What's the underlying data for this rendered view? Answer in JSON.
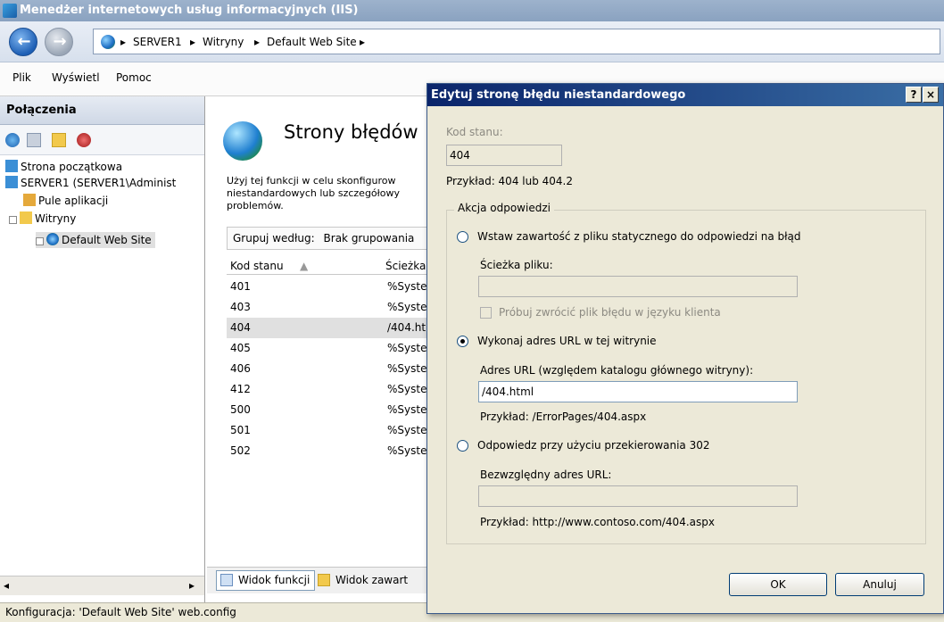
{
  "window": {
    "title": "Menedżer internetowych usług informacyjnych (IIS)"
  },
  "address": {
    "crumbs": [
      "SERVER1",
      "Witryny",
      "Default Web Site"
    ]
  },
  "menu": {
    "items": [
      "Plik",
      "Wyświetl",
      "Pomoc"
    ]
  },
  "connections": {
    "title": "Połączenia",
    "tree": [
      {
        "label": "Strona początkowa"
      },
      {
        "label": "SERVER1 (SERVER1\\Administ"
      },
      {
        "label": "Pule aplikacji"
      },
      {
        "label": "Witryny"
      },
      {
        "label": "Default Web Site"
      }
    ]
  },
  "page": {
    "title": "Strony błędów",
    "desc": "Użyj tej funkcji w celu skonfigurow niestandardowych lub szczegółowy problemów.",
    "group_label": "Grupuj według:",
    "group_value": "Brak grupowania",
    "col_code": "Kod stanu",
    "col_path": "Ścieżka",
    "rows": [
      {
        "code": "401",
        "path": "%Systen"
      },
      {
        "code": "403",
        "path": "%Systen"
      },
      {
        "code": "404",
        "path": "/404.htm"
      },
      {
        "code": "405",
        "path": "%Systen"
      },
      {
        "code": "406",
        "path": "%Systen"
      },
      {
        "code": "412",
        "path": "%Systen"
      },
      {
        "code": "500",
        "path": "%Systen"
      },
      {
        "code": "501",
        "path": "%Systen"
      },
      {
        "code": "502",
        "path": "%Systen"
      }
    ],
    "tab_features": "Widok funkcji",
    "tab_content": "Widok zawart"
  },
  "status": {
    "text": "Konfiguracja: 'Default Web Site' web.config"
  },
  "dialog": {
    "title": "Edytuj stronę błędu niestandardowego",
    "help_btn": "?",
    "close_btn": "×",
    "status_label": "Kod stanu:",
    "status_value": "404",
    "status_example": "Przykład: 404 lub 404.2",
    "group_label": "Akcja odpowiedzi",
    "opt_static": "Wstaw zawartość z pliku statycznego do odpowiedzi na błąd",
    "file_path_label": "Ścieżka pliku:",
    "file_path_value": "",
    "localized_label": "Próbuj zwrócić plik błędu w języku klienta",
    "opt_url": "Wykonaj adres URL w tej witrynie",
    "url_label": "Adres URL (względem katalogu głównego witryny):",
    "url_value": "/404.html",
    "url_example": "Przykład: /ErrorPages/404.aspx",
    "opt_redirect": "Odpowiedz przy użyciu przekierowania 302",
    "abs_url_label": "Bezwzględny adres URL:",
    "abs_url_value": "",
    "abs_url_example": "Przykład: http://www.contoso.com/404.aspx",
    "ok": "OK",
    "cancel": "Anuluj",
    "selected_option": "url"
  }
}
